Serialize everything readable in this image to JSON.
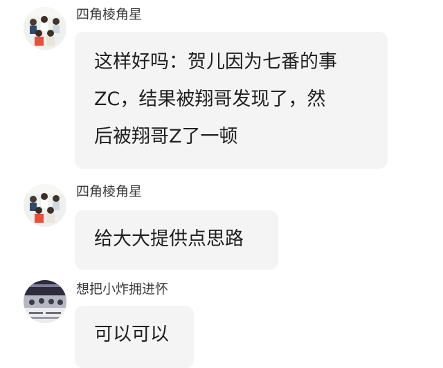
{
  "messages": [
    {
      "username": "四角棱角星",
      "avatar": "group-photo-avatar",
      "lines": [
        "这样好吗：贺儿因为七番的事",
        "ZC，结果被翔哥发现了，然",
        "后被翔哥Z了一顿"
      ]
    },
    {
      "username": "四角棱角星",
      "avatar": "group-photo-avatar",
      "lines": [
        "给大大提供点思路"
      ]
    },
    {
      "username": "想把小炸拥进怀",
      "avatar": "concert-photo-avatar",
      "lines": [
        "可以可以"
      ]
    }
  ],
  "colors": {
    "background": "#ffffff",
    "bubble": "#f4f4f4",
    "text": "#202020",
    "username": "#3a3a3a"
  }
}
